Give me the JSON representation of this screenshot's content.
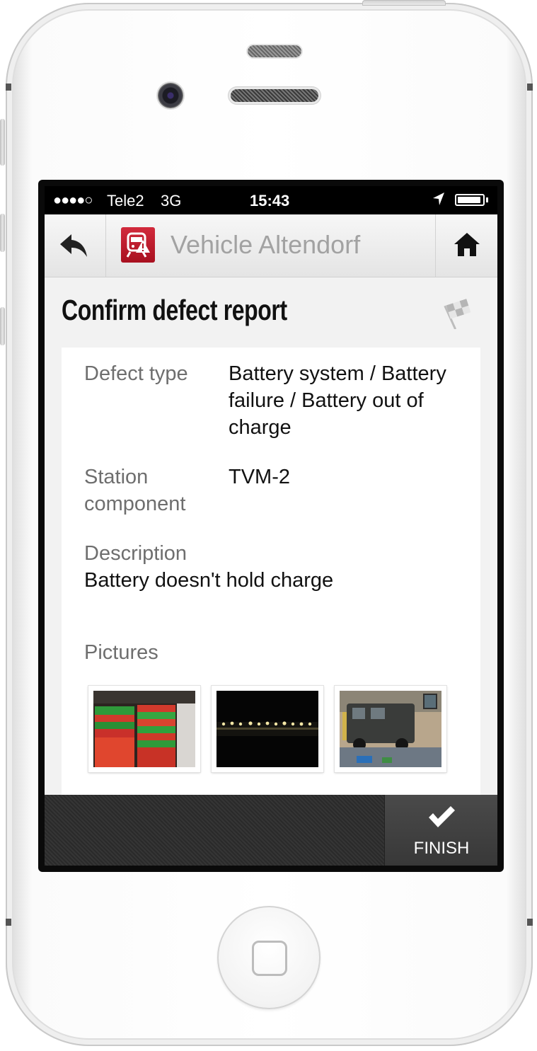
{
  "status_bar": {
    "signal": "●●●●○",
    "carrier": "Tele2",
    "network": "3G",
    "time": "15:43"
  },
  "nav": {
    "title": "Vehicle Altendorf",
    "back_icon": "back-arrow-icon",
    "logo_icon": "train-warning-icon",
    "home_icon": "home-icon"
  },
  "page": {
    "title": "Confirm defect report",
    "flag_icon": "checkered-flag-icon"
  },
  "details": {
    "defect_type_label": "Defect type",
    "defect_type_line1": "Battery system / Battery",
    "defect_type_line2": "failure / Battery out of",
    "defect_type_line3": "charge",
    "station_component_label_line1": "Station",
    "station_component_label_line2": "component",
    "station_component_value": "TVM-2",
    "description_label": "Description",
    "description_value": "Battery doesn't hold charge",
    "pictures_label": "Pictures"
  },
  "pictures": [
    {
      "subject": "stacked red and green crates"
    },
    {
      "subject": "night view of lit building"
    },
    {
      "subject": "vehicle in workshop"
    }
  ],
  "bottom_bar": {
    "finish_label": "FINISH",
    "finish_icon": "checkmark-icon"
  },
  "colors": {
    "brand_red": "#c41c2e",
    "nav_title": "#a2a2a2",
    "label_gray": "#6e6e6e"
  }
}
